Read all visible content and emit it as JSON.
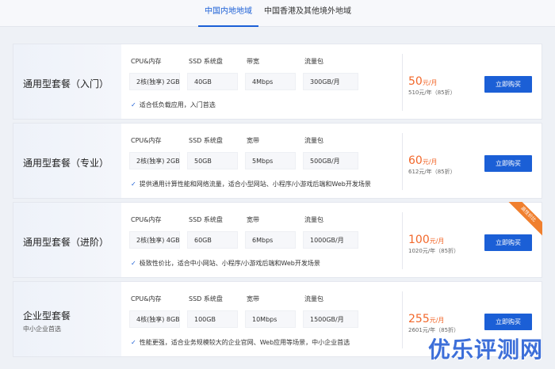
{
  "tabs": [
    {
      "label": "中国内地地域"
    },
    {
      "label": "中国香港及其他境外地域"
    }
  ],
  "spec_labels": {
    "cpu": "CPU&内存",
    "disk": "SSD 系统盘",
    "bandwidth": "带宽",
    "traffic": "流量包"
  },
  "buy_label": "立即购买",
  "plans": [
    {
      "name": "通用型套餐（入门）",
      "subtitle": "",
      "bandwidth_label": "带宽",
      "cpu": "2核(独享) 2GB",
      "disk": "40GB",
      "bandwidth": "4Mbps",
      "traffic": "300GB/月",
      "note": "适合低负载应用，入门首选",
      "price": "50",
      "price_unit": "元/月",
      "year_price": "510元/年（85折）",
      "ribbon": ""
    },
    {
      "name": "通用型套餐（专业）",
      "subtitle": "",
      "bandwidth_label": "宽带",
      "cpu": "2核(独享) 2GB",
      "disk": "50GB",
      "bandwidth": "5Mbps",
      "traffic": "500GB/月",
      "note": "提供通用计算性能和网络流量，适合小型网站、小程序/小游戏后端和Web开发场景",
      "price": "60",
      "price_unit": "元/月",
      "year_price": "612元/年（85折）",
      "ribbon": ""
    },
    {
      "name": "通用型套餐（进阶）",
      "subtitle": "",
      "bandwidth_label": "宽带",
      "cpu": "2核(独享) 4GB",
      "disk": "60GB",
      "bandwidth": "6Mbps",
      "traffic": "1000GB/月",
      "note": "极致性价比，适合中小网站、小程序/小游戏后端和Web开发场景",
      "price": "100",
      "price_unit": "元/月",
      "year_price": "1020元/年（85折）",
      "ribbon": "高性价比"
    },
    {
      "name": "企业型套餐",
      "subtitle": "中小企业首选",
      "bandwidth_label": "宽带",
      "cpu": "4核(独享) 8GB",
      "disk": "100GB",
      "bandwidth": "10Mbps",
      "traffic": "1500GB/月",
      "note": "性能更强，适合业务规模较大的企业官网、Web应用等场景，中小企业首选",
      "price": "255",
      "price_unit": "元/月",
      "year_price": "2601元/年（85折）",
      "ribbon": ""
    }
  ],
  "watermark": "优乐评测网",
  "colors": {
    "accent": "#1b5fd6",
    "price": "#f2672a",
    "ribbon": "#f07f2e"
  }
}
